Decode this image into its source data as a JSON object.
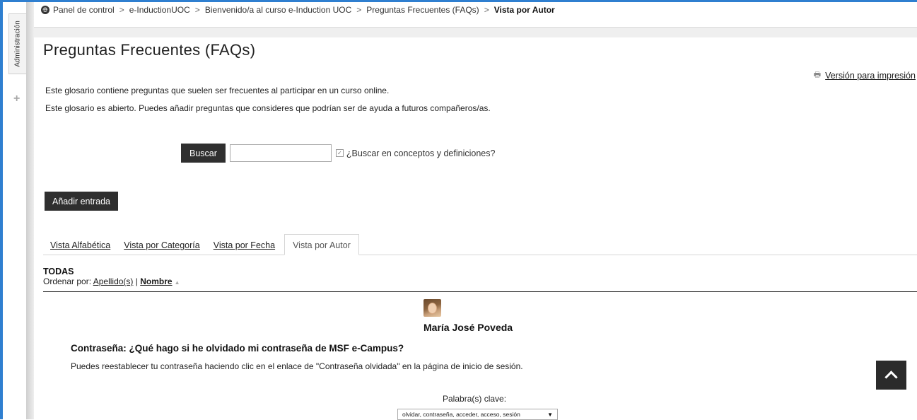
{
  "breadcrumb": {
    "items": [
      "Panel de control",
      "e-InductionUOC",
      "Bienvenido/a al curso e-Induction UOC",
      "Preguntas Frecuentes (FAQs)"
    ],
    "separator": ">",
    "current": "Vista por Autor"
  },
  "sidebar": {
    "admin_label": "Administración",
    "add_symbol": "+"
  },
  "page": {
    "title": "Preguntas Frecuentes (FAQs)",
    "print_link": "Versión para impresión",
    "description_1": "Este glosario contiene preguntas que suelen ser frecuentes al participar en un curso online.",
    "description_2": "Este glosario es abierto. Puedes añadir preguntas que consideres que podrían ser de ayuda a futuros compañeros/as."
  },
  "search": {
    "button_label": "Buscar",
    "input_value": "",
    "checkbox_label": "¿Buscar en conceptos y definiciones?",
    "checkbox_checked": true
  },
  "actions": {
    "add_entry_label": "Añadir entrada"
  },
  "tabs": [
    {
      "label": "Vista Alfabética",
      "active": false
    },
    {
      "label": "Vista por Categoría",
      "active": false
    },
    {
      "label": "Vista por Fecha",
      "active": false
    },
    {
      "label": "Vista por Autor",
      "active": true
    }
  ],
  "listing": {
    "filter_label": "TODAS",
    "sort_prefix": "Ordenar por:",
    "sort_option_1": "Apellido(s)",
    "sort_separator": "|",
    "sort_option_2": "Nombre",
    "sort_direction": "ascending"
  },
  "entry": {
    "author": "María José Poveda",
    "concept": "Contraseña: ¿Qué hago si he olvidado mi contraseña de MSF e-Campus?",
    "definition": "Puedes reestablecer tu contraseña haciendo clic en el enlace de \"Contraseña olvidada\" en la página de inicio de sesión.",
    "keywords_label": "Palabra(s) clave:",
    "keywords_value": "olvidar, contraseña, acceder, acceso, sesión"
  },
  "colors": {
    "frame_accent": "#2f7fd0",
    "button_dark": "#2f2f2f",
    "scroll_top_bg": "#2b2b2b"
  }
}
